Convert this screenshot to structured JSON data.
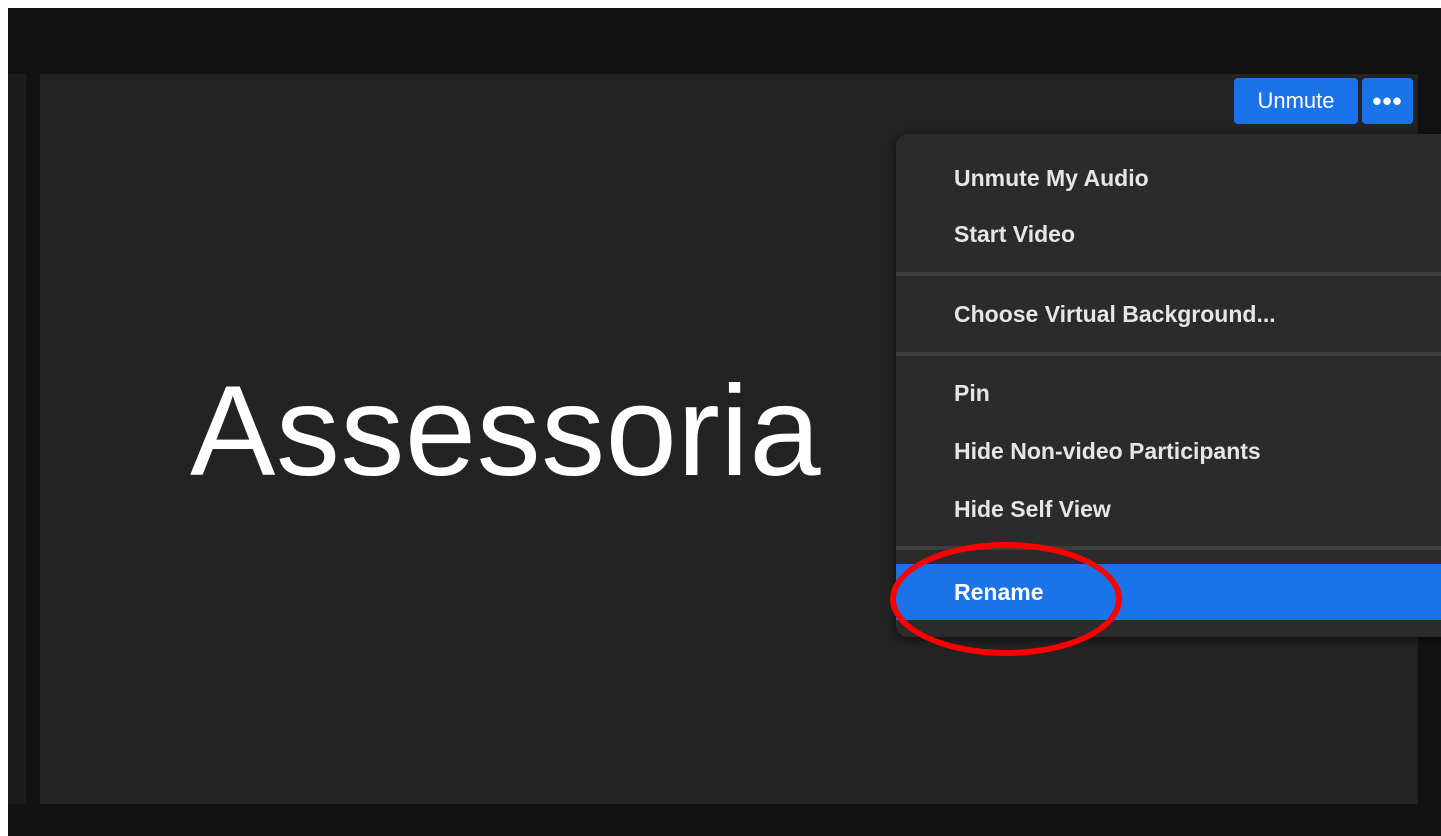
{
  "tile": {
    "display_name": "Assessoria"
  },
  "controls": {
    "unmute_label": "Unmute",
    "more_label": "•••",
    "accent_color": "#1a73e8"
  },
  "menu": {
    "items": [
      {
        "label": "Unmute My Audio"
      },
      {
        "label": "Start Video"
      },
      {
        "label": "Choose Virtual Background..."
      },
      {
        "label": "Pin"
      },
      {
        "label": "Hide Non-video Participants"
      },
      {
        "label": "Hide Self View"
      },
      {
        "label": "Rename",
        "highlighted": true
      }
    ]
  },
  "annotation": {
    "target": "Rename",
    "color": "#ff0000"
  }
}
